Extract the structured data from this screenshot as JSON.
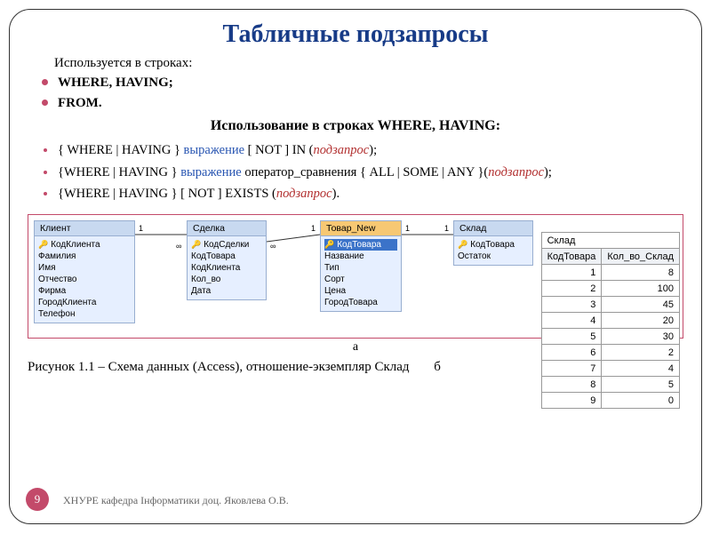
{
  "title": "Табличные подзапросы",
  "intro": "Используется в строках:",
  "bullets1": [
    "WHERE, HAVING;",
    "FROM."
  ],
  "subhead": "Использование в строках WHERE, HAVING:",
  "rules": [
    {
      "a": "{ WHERE | HAVING } ",
      "b": "выражение",
      "c": " [ NOT ] IN (",
      "d": "подзапрос",
      "e": ");"
    },
    {
      "a": "{WHERE | HAVING } ",
      "b": "выражение",
      "c": "   оператор_сравнения { ALL | SOME | ANY }(",
      "d": "подзапрос",
      "e": ");"
    },
    {
      "a": "{WHERE | HAVING } [ NOT ] EXISTS (",
      "b": "",
      "c": "",
      "d": "подзапрос",
      "e": ")."
    }
  ],
  "entities": {
    "client": {
      "name": "Клиент",
      "fields": [
        "КодКлиента",
        "Фамилия",
        "Имя",
        "Отчество",
        "Фирма",
        "ГородКлиента",
        "Телефон"
      ],
      "key": 0
    },
    "deal": {
      "name": "Сделка",
      "fields": [
        "КодСделки",
        "КодТовара",
        "КодКлиента",
        "Кол_во",
        "Дата"
      ],
      "key": 0
    },
    "tovar": {
      "name": "Товар_New",
      "fields": [
        "КодТовара",
        "Название",
        "Тип",
        "Сорт",
        "Цена",
        "ГородТовара"
      ],
      "key": 0
    },
    "sklad": {
      "name": "Склад",
      "fields": [
        "КодТовара",
        "Остаток"
      ],
      "key": 0
    }
  },
  "rel": {
    "one": "1",
    "many": "∞"
  },
  "sklad_table": {
    "title": "Склад",
    "cols": [
      "КодТовара",
      "Кол_во_Склад"
    ],
    "rows": [
      [
        "1",
        "8"
      ],
      [
        "2",
        "100"
      ],
      [
        "3",
        "45"
      ],
      [
        "4",
        "20"
      ],
      [
        "5",
        "30"
      ],
      [
        "6",
        "2"
      ],
      [
        "7",
        "4"
      ],
      [
        "8",
        "5"
      ],
      [
        "9",
        "0"
      ]
    ]
  },
  "label_a": "а",
  "caption": "Рисунок 1.1 – Схема данных (Access), отношение-экземпляр Склад",
  "label_b": "б",
  "page": "9",
  "footer": "ХНУРЕ кафедра Інформатики доц. Яковлева О.В."
}
